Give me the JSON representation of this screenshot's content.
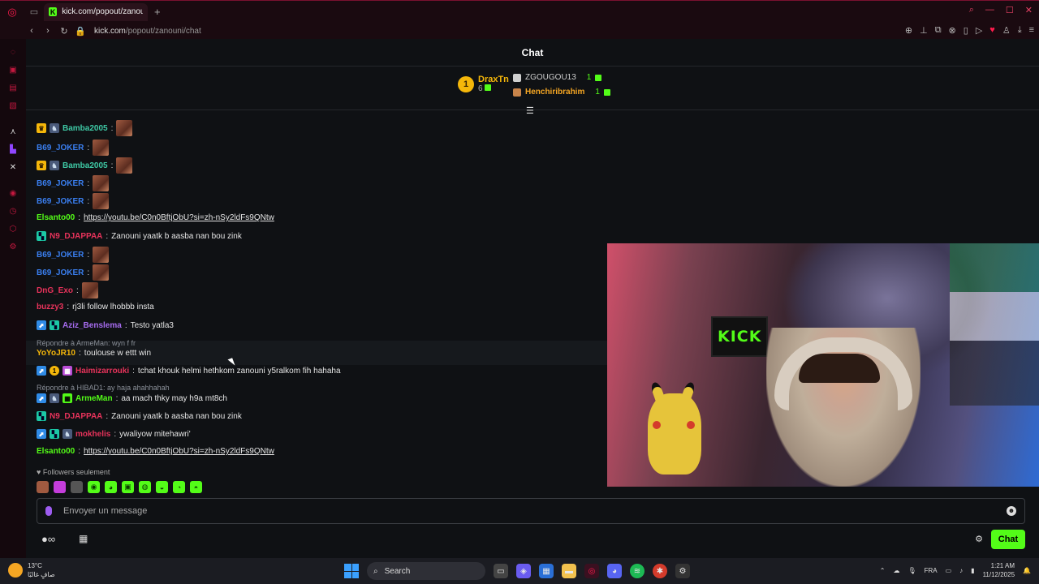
{
  "browser": {
    "tab_title": "kick.com/popout/zanoun",
    "url_host": "kick.com",
    "url_path": "/popout/zanouni/chat"
  },
  "chat": {
    "title": "Chat",
    "leaderboard": {
      "first": {
        "rank": "1",
        "name": "DraxTn",
        "count": "6"
      },
      "others": [
        {
          "name": "ZGOUGOU13",
          "count": "1",
          "color": "#cfcfcf"
        },
        {
          "name": "Henchiribrahim",
          "count": "1",
          "color": "#f5a623"
        }
      ]
    },
    "messages": [
      {
        "user": "Bamba2005",
        "color": "#3ec9a5",
        "text": ""
      },
      {
        "user": "B69_JOKER",
        "color": "#3a7ff0",
        "text": ""
      },
      {
        "user": "Bamba2005",
        "color": "#3ec9a5",
        "text": ""
      },
      {
        "user": "B69_JOKER",
        "color": "#3a7ff0",
        "text": ""
      },
      {
        "user": "B69_JOKER",
        "color": "#3a7ff0",
        "text": ""
      },
      {
        "user": "Elsanto00",
        "color": "#53fc18",
        "text": "https://youtu.be/C0n0BftjObU?si=zh-nSy2ldFs9QNtw"
      },
      {
        "user": "N9_DJAPPAA",
        "color": "#e8335b",
        "text": "Zanouni yaatk b aasba nan bou zink"
      },
      {
        "user": "B69_JOKER",
        "color": "#3a7ff0",
        "text": ""
      },
      {
        "user": "B69_JOKER",
        "color": "#3a7ff0",
        "text": ""
      },
      {
        "user": "DnG_Exo",
        "color": "#e8335b",
        "text": ""
      },
      {
        "user": "buzzy3",
        "color": "#e8335b",
        "text": "rj3li follow lhobbb insta"
      },
      {
        "user": "Aziz_Benslema",
        "color": "#a76cf0",
        "text": "Testo yatla3"
      },
      {
        "user": "YoYoJR10",
        "color": "#f5b70a",
        "text": "toulouse w ettt win"
      },
      {
        "user": "Haimizarrouki",
        "color": "#e8335b",
        "text": "tchat khouk helmi hethkom zanouni y5ralkom fih hahaha"
      },
      {
        "user": "ArmeMan",
        "color": "#53fc18",
        "text": "aa mach thky may h9a mt8ch"
      },
      {
        "user": "N9_DJAPPAA",
        "color": "#e8335b",
        "text": "Zanouni yaatk b aasba nan bou zink"
      },
      {
        "user": "mokhelis",
        "color": "#e8335b",
        "text": "ywaliyow mitehawri'"
      },
      {
        "user": "Elsanto00",
        "color": "#53fc18",
        "text": "https://youtu.be/C0n0BftjObU?si=zh-nSy2ldFs9QNtw"
      }
    ],
    "replies": [
      {
        "text": "Répondre à ArmeMan: wyn f fr"
      },
      {
        "text": "Répondre à HIBAD1: ay haja ahahhahah"
      }
    ],
    "followers_only": "Followers seulement",
    "input_placeholder": "Envoyer un message",
    "send_label": "Chat"
  },
  "video": {
    "sign_text": "KICK"
  },
  "taskbar": {
    "temperature": "13°C",
    "weather_text": "صافٍ غالبًا",
    "search_label": "Search",
    "language": "FRA",
    "time": "1:21 AM",
    "date": "11/12/2025"
  },
  "colors": {
    "kick_green": "#53fc18",
    "browser_accent": "#ff1b4d"
  }
}
